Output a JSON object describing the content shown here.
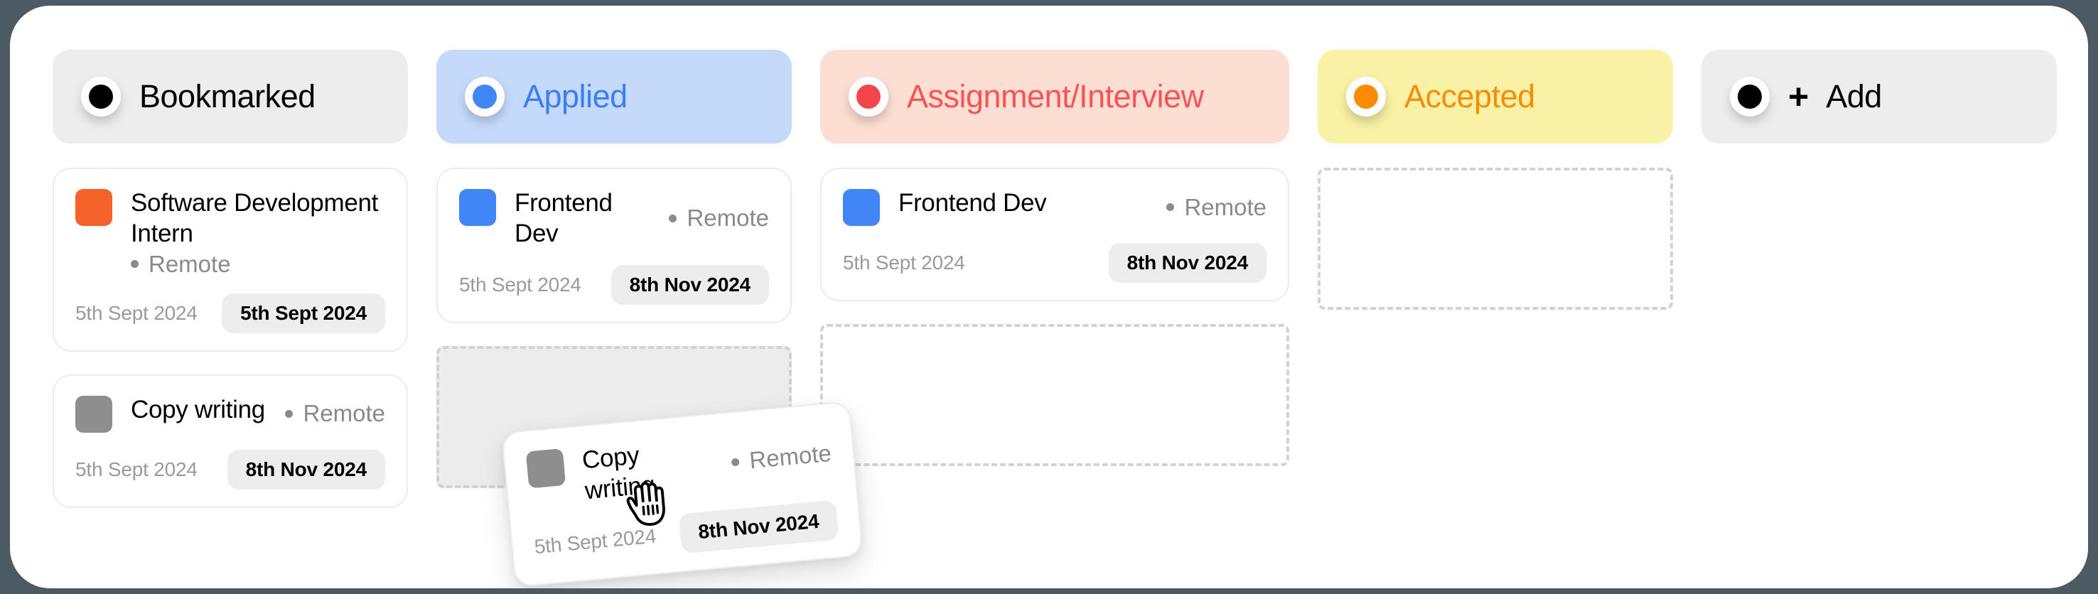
{
  "board": {
    "background_color": "#4c5b63",
    "panel_color": "#ffffff"
  },
  "columns": [
    {
      "id": "bookmarked",
      "header": {
        "label": "Bookmarked",
        "dot_icon": "status-dot-icon",
        "dot_color": "#000000",
        "text_color": "#000000",
        "pill_color": "#ededed"
      },
      "cards": [
        {
          "swatch_color": "#f4622a",
          "title": "Software Development Intern",
          "location": "Remote",
          "date_plain": "5th Sept 2024",
          "date_badge": "5th Sept 2024"
        },
        {
          "swatch_color": "#8e8e8e",
          "title": "Copy writing",
          "location": "Remote",
          "date_plain": "5th Sept 2024",
          "date_badge": "8th Nov 2024"
        }
      ],
      "dropzone": null
    },
    {
      "id": "applied",
      "header": {
        "label": "Applied",
        "dot_icon": "status-dot-icon",
        "dot_color": "#4285f4",
        "text_color": "#3b7df6",
        "pill_color": "#c5d9fb"
      },
      "cards": [
        {
          "swatch_color": "#4285f4",
          "title": "Frontend Dev",
          "location": "Remote",
          "date_plain": "5th Sept 2024",
          "date_badge": "8th Nov 2024"
        }
      ],
      "dropzone": {
        "state": "active"
      }
    },
    {
      "id": "assignment-interview",
      "header": {
        "label": "Assignment/Interview",
        "dot_icon": "status-dot-icon",
        "dot_color": "#f4454a",
        "text_color": "#fa5256",
        "pill_color": "#fcded2"
      },
      "cards": [
        {
          "swatch_color": "#4285f4",
          "title": "Frontend Dev",
          "location": "Remote",
          "date_plain": "5th Sept 2024",
          "date_badge": "8th Nov 2024"
        }
      ],
      "dropzone": {
        "state": "empty"
      }
    },
    {
      "id": "accepted",
      "header": {
        "label": "Accepted",
        "dot_icon": "status-dot-icon",
        "dot_color": "#fb8c00",
        "text_color": "#fb8c00",
        "pill_color": "#f9f1a5"
      },
      "cards": [],
      "dropzone": {
        "state": "empty"
      }
    },
    {
      "id": "add",
      "header": {
        "label": "Add",
        "plus_icon": "plus-icon",
        "dot_icon": "status-dot-icon",
        "dot_color": "#000000",
        "text_color": "#000000",
        "pill_color": "#ededed"
      },
      "cards": [],
      "dropzone": null
    }
  ],
  "drag": {
    "cursor_icon": "grabbing-hand-cursor",
    "card": {
      "swatch_color": "#8e8e8e",
      "title": "Copy writing",
      "location": "Remote",
      "date_plain": "5th Sept 2024",
      "date_badge": "8th Nov 2024"
    }
  }
}
